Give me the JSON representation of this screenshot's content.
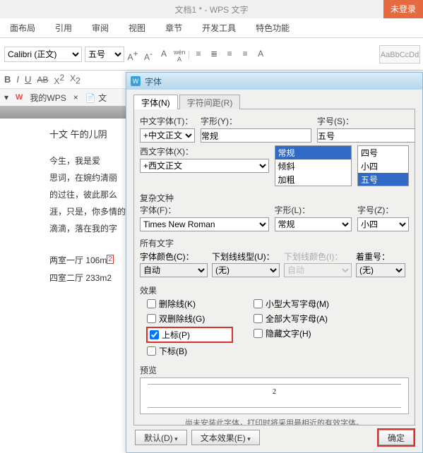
{
  "title": "文档1 * - WPS 文字",
  "not_logged": "未登录",
  "menu": [
    "面布局",
    "引用",
    "审阅",
    "视图",
    "章节",
    "开发工具",
    "特色功能"
  ],
  "ribbon": {
    "font_family": "Calibri (正文)",
    "font_size": "五号",
    "style_preview": "AaBbCcDd"
  },
  "doc_tabs": {
    "wps": "我的WPS",
    "doc": "文"
  },
  "document": {
    "line1_prefix": "十文 午的儿阴",
    "para": "今生，我是爱",
    "para_continue": "思词，在婉约清丽",
    "l3": "的过往，彼此那么",
    "l4": "涯，只是，你多情的",
    "l5": "滴滴，落在我的字",
    "ref1_a": "两室一厅 106m",
    "ref1_b": "2",
    "ref2": "四室二厅 233m2"
  },
  "dialog": {
    "title": "字体",
    "tabs": {
      "font": "字体(N)",
      "spacing": "字符间距(R)"
    },
    "labels": {
      "chinese_font": "中文字体(T)：",
      "style": "字形(Y)：",
      "size": "字号(S)：",
      "western_font": "西文字体(X)：",
      "complex_title": "复杂文种",
      "complex_font": "字体(F)：",
      "complex_style": "字形(L)：",
      "complex_size": "字号(Z)：",
      "all_text": "所有文字",
      "font_color": "字体颜色(C)：",
      "underline_style": "下划线线型(U)：",
      "underline_color": "下划线颜色(I)：",
      "emphasis": "着重号：",
      "effects": "效果",
      "preview": "预览"
    },
    "values": {
      "chinese_font": "+中文正文",
      "western_font": "+西文正文",
      "style": "常规",
      "size": "五号",
      "complex_font": "Times New Roman",
      "complex_style": "常规",
      "complex_size": "小四",
      "font_color": "自动",
      "underline_style": "(无)",
      "underline_color": "自动",
      "emphasis": "(无)"
    },
    "style_options": [
      "常规",
      "倾斜",
      "加粗"
    ],
    "size_options": [
      "四号",
      "小四",
      "五号"
    ],
    "effects_left": {
      "strike": "删除线(K)",
      "dstrike": "双删除线(G)",
      "superscript": "上标(P)",
      "subscript": "下标(B)"
    },
    "effects_right": {
      "smallcaps": "小型大写字母(M)",
      "allcaps": "全部大写字母(A)",
      "hidden": "隐藏文字(H)"
    },
    "preview_text": "2",
    "preview_note": "尚未安装此字体，打印时将采用最相近的有效字体。",
    "buttons": {
      "default": "默认(D)",
      "text_effects": "文本效果(E)",
      "ok": "确定"
    }
  }
}
